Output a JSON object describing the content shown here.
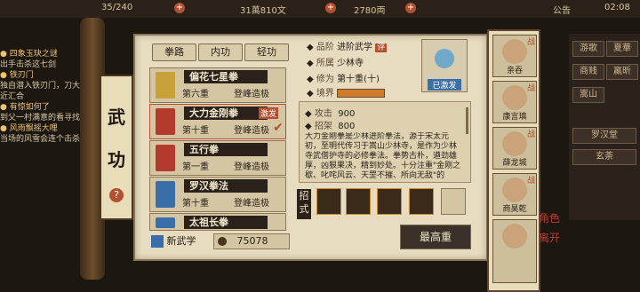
{
  "topbar": {
    "stamina": "35/240",
    "coins": "31萬810文",
    "gold": "2780両",
    "notice": "公告",
    "time": "02:08"
  },
  "quests": [
    {
      "title": "● 四象玉玦之谜",
      "note": "出手击杀这七剑"
    },
    {
      "title": "● 铁刃门",
      "note": "独自潜入铁刃门，刀大殿附近汇合"
    },
    {
      "title": "● 有惊如何了",
      "note": "到父一村满意的看寻找线索"
    },
    {
      "title": "● 风雨飘摇大哩",
      "note": "当场的风雪会连个击杀"
    }
  ],
  "scroll": {
    "title_1": "武",
    "title_2": "功",
    "help": "?"
  },
  "tabs": [
    "拳路",
    "内功",
    "轻功"
  ],
  "skills": [
    {
      "name": "偏花七星拳",
      "level": "第六重",
      "peak": "登峰造极",
      "book_color": "#c8a13a"
    },
    {
      "name": "大力金刚拳",
      "level": "第十重",
      "peak": "登峰造极",
      "badge": "激发",
      "book_color": "#b43a2e"
    },
    {
      "name": "五行拳",
      "level": "第一重",
      "peak": "登峰造极",
      "book_color": "#b43a2e"
    },
    {
      "name": "罗汉拳法",
      "level": "第十重",
      "peak": "登峰造极",
      "book_color": "#3a6ea8"
    },
    {
      "name": "太祖长拳",
      "level": "",
      "peak": "",
      "book_color": "#3a6ea8"
    }
  ],
  "footer": {
    "new_skill": "新武学",
    "points": "75078"
  },
  "detail": {
    "grade_label": "品阶",
    "grade": "进阶武学",
    "school_label": "所属",
    "school": "少林寺",
    "cultivation_label": "修为",
    "cultivation": "第十重(十)",
    "realm_label": "境界",
    "mastered": "已激发",
    "attack_label": "攻击",
    "attack": "900",
    "parry_label": "招架",
    "parry": "800",
    "description": "大力金刚拳是少林进阶拳法，源于宋太元初，至明代传习于嵩山少林寺，是作为少林寺武僧护寺的必修拳法。拳势古朴，遒劲雄厚，凶狠果决，精到妙处。十分注重\"金刚之歇、叱咤风云、天罡不摧、所向无敌\"的",
    "moves_label": "招式",
    "max_button": "最高重"
  },
  "roster": [
    {
      "name": "亲吞",
      "tag": "战"
    },
    {
      "name": "康言瑱",
      "tag": "战"
    },
    {
      "name": "薛龙城",
      "tag": "战"
    },
    {
      "name": "商昊乾",
      "tag": "战"
    },
    {
      "name": "",
      "tag": ""
    }
  ],
  "rmenu": [
    "游歌",
    "夏華",
    "商贱",
    "嬴昕",
    "嵩山"
  ],
  "rmenu_subs": [
    "罗汉堂",
    "玄荼"
  ],
  "side_text": [
    "角色",
    "离开"
  ]
}
